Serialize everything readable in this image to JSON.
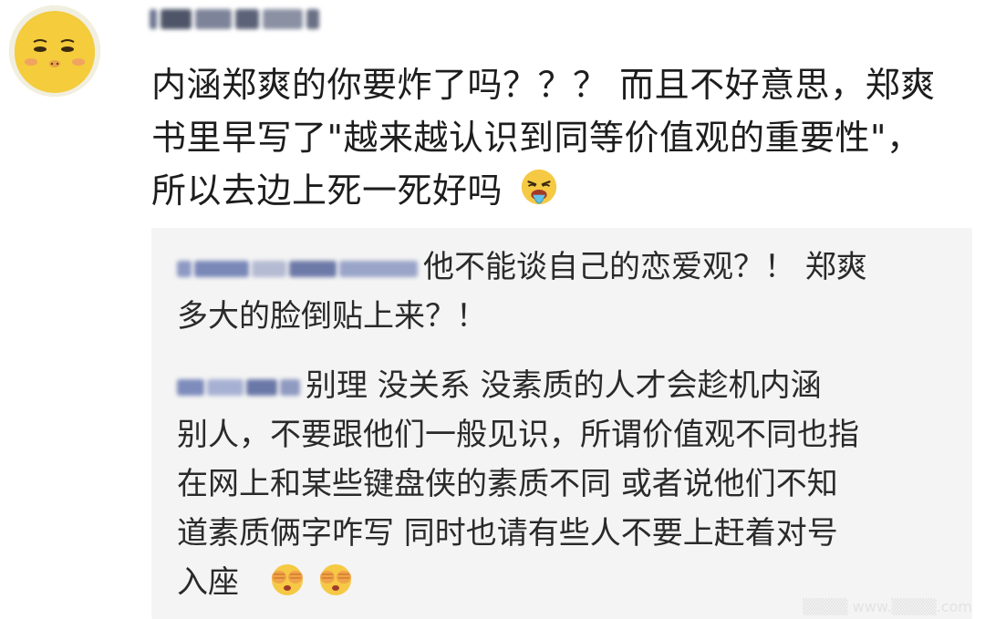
{
  "comment": {
    "lines": [
      "内涵郑爽的你要炸了吗？？？ 而且不好意思，郑爽",
      "书里早写了\"越来越认识到同等价值观的重要性\"，",
      "所以去边上死一死好吗"
    ],
    "emoji": "vomit-face-icon"
  },
  "replies": [
    {
      "lines": [
        "他不能谈自己的恋爱观？！ 郑爽",
        "多大的脸倒贴上来？！"
      ]
    },
    {
      "lines": [
        "别理  没关系  没素质的人才会趁机内涵",
        "别人，不要跟他们一般见识，所谓价值观不同也指",
        "在网上和某些键盘侠的素质不同  或者说他们不知",
        "道素质俩字咋写  同时也请有些人不要上赶着对号",
        "入座"
      ],
      "emojis": [
        "covering-eyes-face-icon",
        "covering-eyes-face-icon"
      ]
    }
  ],
  "colors": {
    "text": "#1d1d1d",
    "reply_bg": "#f4f4f4",
    "reply_text": "#2a2a2a",
    "username_blur": "#5a6a8a"
  }
}
